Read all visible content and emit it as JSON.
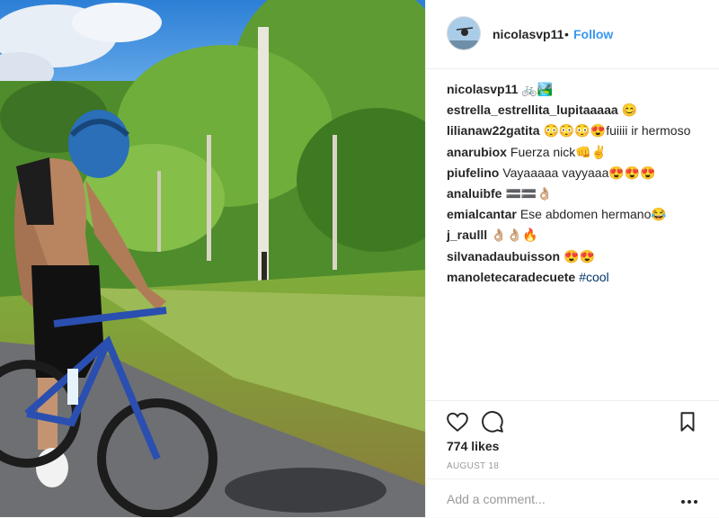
{
  "post": {
    "username": "nicolasvp11",
    "separator": "•",
    "follow_label": "Follow",
    "likes": "774 likes",
    "date": "AUGUST 18",
    "photo_label": "Photo of a shirtless cyclist in a blue helmet beside a bike on a forest trail"
  },
  "comments": [
    {
      "user": "nicolasvp11",
      "text": "🚲🏞️"
    },
    {
      "user": "estrella_estrellita_lupitaaaaa",
      "text": "😊"
    },
    {
      "user": "lilianaw22gatita",
      "text": "😳😳😳😍fuiiii ir hermoso"
    },
    {
      "user": "anarubiox",
      "text": "Fuerza nick👊✌️"
    },
    {
      "user": "piufelino",
      "text": "Vayaaaaa vayyaaa😍😍😍"
    },
    {
      "user": "analuibfe",
      "text": "🟰🟰👌🏼"
    },
    {
      "user": "emialcantar",
      "text": "Ese abdomen hermano😂"
    },
    {
      "user": "j_raulll",
      "text": "👌🏼👌🏼🔥"
    },
    {
      "user": "silvanadaubuisson",
      "text": "😍😍"
    },
    {
      "user": "manoletecaradecuete",
      "text": "",
      "tag": "#cool"
    }
  ],
  "add_comment": {
    "placeholder": "Add a comment..."
  },
  "icons": {
    "like": "heart-icon",
    "comment": "speech-bubble-icon",
    "save": "bookmark-icon",
    "more": "ellipsis-icon"
  },
  "colors": {
    "link": "#3897f0",
    "text": "#262626",
    "muted": "#999999",
    "hashtag": "#003569"
  }
}
